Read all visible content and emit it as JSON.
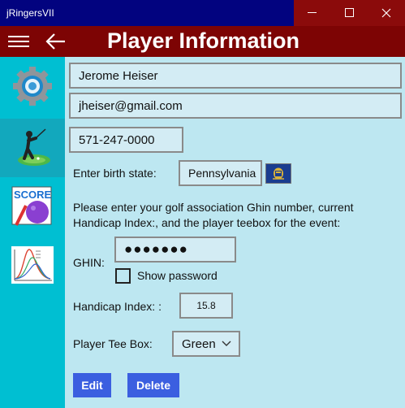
{
  "window": {
    "title": "jRingersVII",
    "controls": [
      "minimize",
      "maximize",
      "close"
    ],
    "titlebar_color": "#02037f",
    "controls_color": "#8b0b0b"
  },
  "appbar": {
    "title": "Player Information",
    "menu_icon": "hamburger-icon",
    "back_icon": "back-arrow-icon",
    "color": "#7d0404"
  },
  "sidebar": {
    "color": "#00bfd2",
    "items": [
      {
        "icon": "settings-gear-icon",
        "selected": false
      },
      {
        "icon": "golfer-icon",
        "selected": true
      },
      {
        "icon": "scorecard-icon",
        "selected": false
      },
      {
        "icon": "statistics-chart-icon",
        "selected": false
      }
    ]
  },
  "form": {
    "name_value": "Jerome Heiser",
    "email_value": "jheiser@gmail.com",
    "phone_value": "571-247-0000",
    "birth_state_label": "Enter birth state:",
    "birth_state_value": "Pennsylvania",
    "state_flag_icon": "pennsylvania-flag-icon",
    "instructions": "Please enter your golf association Ghin number, current Handicap Index:, and the player teebox for the event:",
    "ghin_label": "GHIN:",
    "ghin_value": "●●●●●●●",
    "show_password_label": "Show password",
    "show_password_checked": false,
    "handicap_label": "Handicap Index: :",
    "handicap_value": "15.8",
    "teebox_label": "Player Tee Box:",
    "teebox_value": "Green"
  },
  "buttons": {
    "edit_label": "Edit",
    "delete_label": "Delete",
    "color": "#3b5fe0"
  }
}
